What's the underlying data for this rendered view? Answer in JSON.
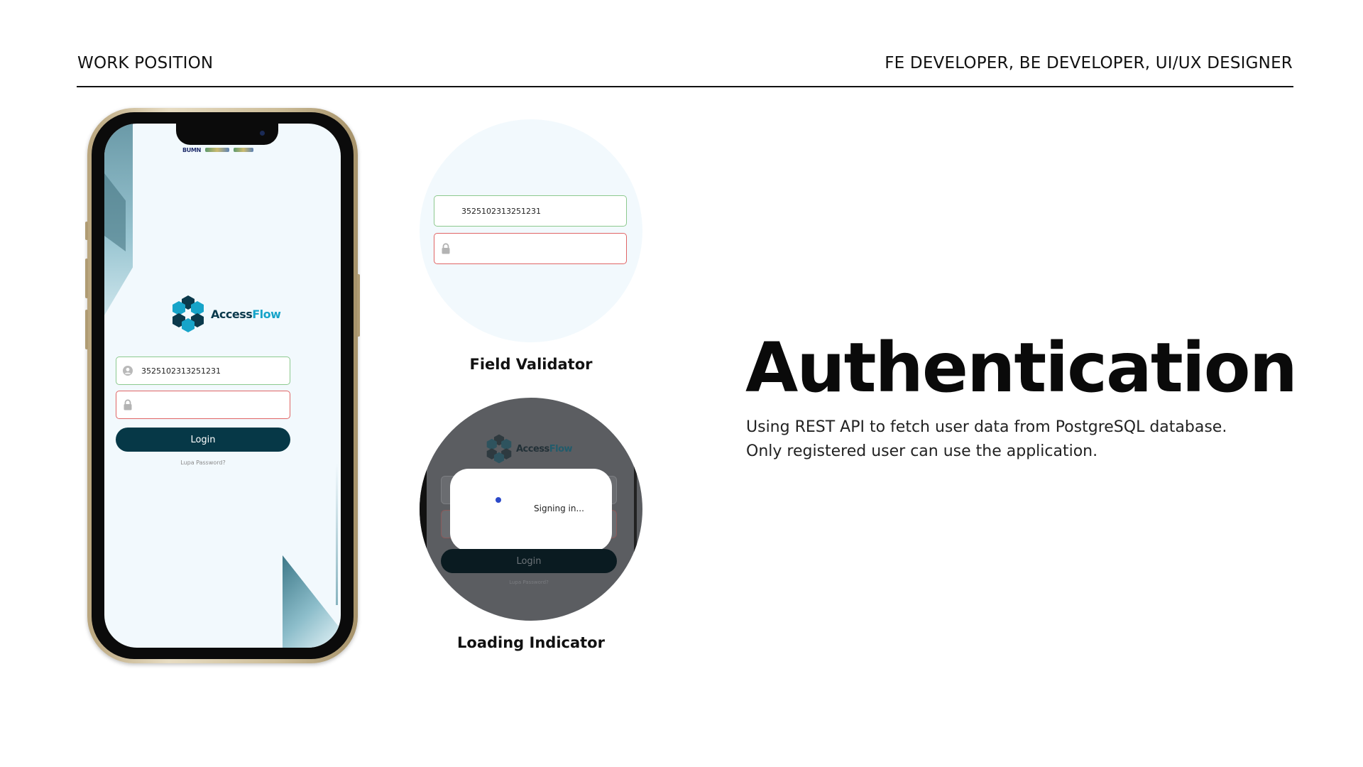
{
  "header": {
    "left_label": "WORK POSITION",
    "right_label": "FE DEVELOPER, BE DEVELOPER, UI/UX DESIGNER"
  },
  "phone": {
    "sponsor_logo_text": "BUMN",
    "brand": {
      "part1": "Access",
      "part2": "Flow"
    },
    "id_field_value": "3525102313251231",
    "password_field_value": "",
    "login_label": "Login",
    "forgot_label": "Lupa Password?"
  },
  "field_validator": {
    "id_field_value": "3525102313251231",
    "password_field_value": "",
    "caption": "Field Validator"
  },
  "loading_indicator": {
    "brand": {
      "part1": "Access",
      "part2": "Flow"
    },
    "dialog_text": "Signing in...",
    "login_label": "Login",
    "forgot_label": "Lupa Password?",
    "caption": "Loading Indicator"
  },
  "section": {
    "title": "Authentication",
    "description_lines": [
      "Using REST API to fetch user data from PostgreSQL database.",
      "Only registered user can use the application."
    ]
  },
  "colors": {
    "brand_dark": "#0b3a4c",
    "brand_accent": "#17a4c9",
    "valid_border": "#8cc98e",
    "invalid_border": "#e06565",
    "button_bg": "#063847",
    "spinner": "#2b49c9"
  }
}
